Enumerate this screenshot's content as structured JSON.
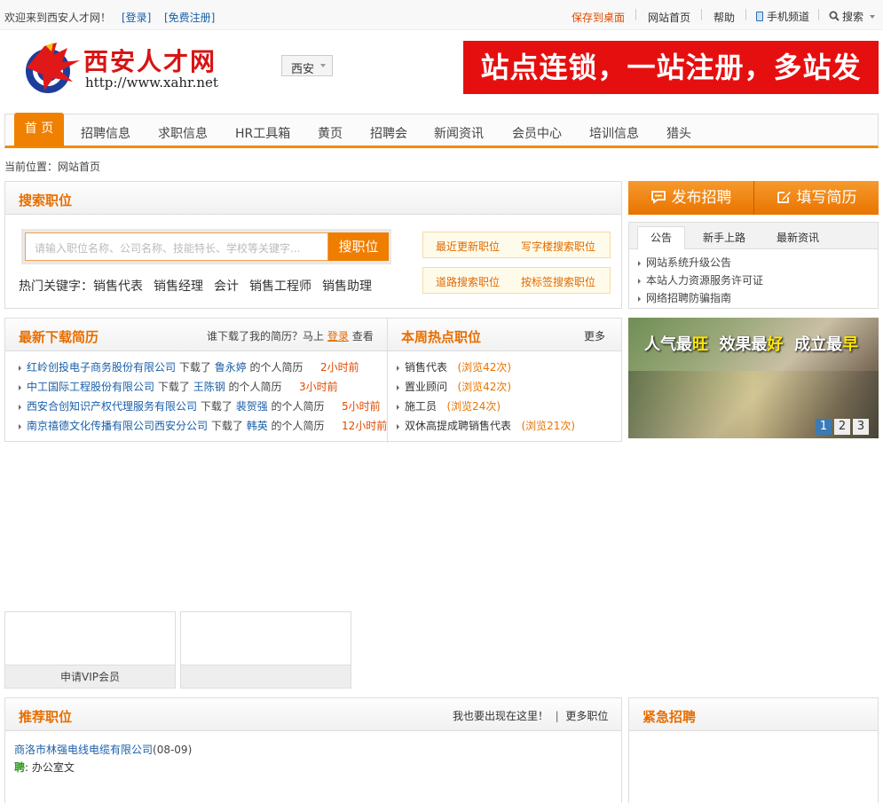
{
  "topbar": {
    "welcome": "欢迎来到西安人才网！",
    "login": "[登录]",
    "register": "[免费注册]",
    "save_desktop": "保存到桌面",
    "site_home": "网站首页",
    "help": "帮助",
    "mobile": "手机频道",
    "search": "搜索"
  },
  "header": {
    "logo_text": "西安人才网",
    "logo_url": "http://www.xahr.net",
    "city": "西安",
    "banner_text": "站点连锁，一站注册，多站发布!"
  },
  "nav": {
    "items": [
      "首 页",
      "招聘信息",
      "求职信息",
      "HR工具箱",
      "黄页",
      "招聘会",
      "新闻资讯",
      "会员中心",
      "培训信息",
      "猎头"
    ]
  },
  "breadcrumb": "当前位置：网站首页",
  "search_panel": {
    "title": "搜索职位",
    "placeholder": "请输入职位名称、公司名称、技能特长、学校等关键字...",
    "button": "搜职位",
    "hot_label": "热门关键字：",
    "hot_keywords": [
      "销售代表",
      "销售经理",
      "会计",
      "销售工程师",
      "销售助理"
    ],
    "quick_links": [
      "最近更新职位",
      "写字楼搜索职位",
      "道路搜索职位",
      "按标签搜索职位"
    ]
  },
  "actions": {
    "post_job": "发布招聘",
    "write_resume": "填写简历"
  },
  "notice": {
    "tabs": [
      "公告",
      "新手上路",
      "最新资讯"
    ],
    "items": [
      "网站系统升级公告",
      "本站人力资源服务许可证",
      "网络招聘防骗指南"
    ]
  },
  "downloads": {
    "title": "最新下载简历",
    "hint_prefix": "谁下载了我的简历？马上",
    "hint_login": "登录",
    "hint_suffix": "查看",
    "verb": "下载了",
    "resume_suffix": "的个人简历",
    "rows": [
      {
        "company": "红岭创投电子商务股份有限公司",
        "person": "鲁永婷",
        "time": "2小时前"
      },
      {
        "company": "中工国际工程股份有限公司",
        "person": "王陈钢",
        "time": "3小时前"
      },
      {
        "company": "西安合创知识产权代理服务有限公司",
        "person": "裴贺强",
        "time": "5小时前"
      },
      {
        "company": "南京禧德文化传播有限公司西安分公司",
        "person": "韩英",
        "time": "12小时前"
      }
    ]
  },
  "hot_jobs": {
    "title": "本周热点职位",
    "more": "更多",
    "rows": [
      {
        "job": "销售代表",
        "views": "(浏览42次)"
      },
      {
        "job": "置业顾问",
        "views": "(浏览42次)"
      },
      {
        "job": "施工员",
        "views": "(浏览24次)"
      },
      {
        "job": "双休高提成聘销售代表",
        "views": "(浏览21次)"
      }
    ]
  },
  "slideshow": {
    "slogan_parts": [
      "人气最",
      "旺",
      "  效果最",
      "好",
      "  成立最",
      "早"
    ],
    "pages": [
      "1",
      "2",
      "3"
    ]
  },
  "vip": {
    "apply": "申请VIP会员"
  },
  "recommend": {
    "title": "推荐职位",
    "hint": "我也要出现在这里！",
    "divider": "|",
    "more": "更多职位",
    "company": "商洛市林强电线电缆有限公司",
    "date": "(08-09)",
    "tag": "聘",
    "job": ": 办公室文"
  },
  "urgent": {
    "title": "紧急招聘"
  }
}
